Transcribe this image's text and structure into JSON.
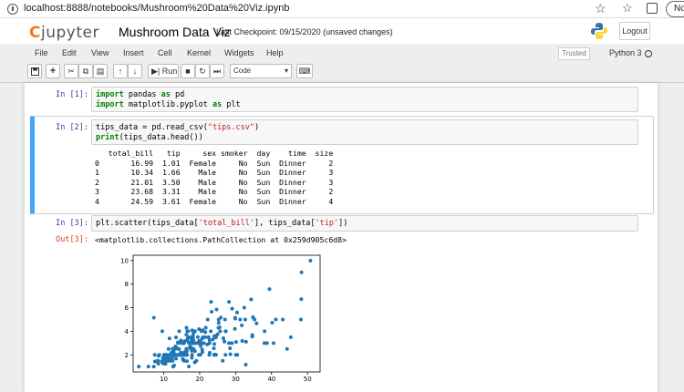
{
  "browser": {
    "url": "localhost:8888/notebooks/Mushroom%20Data%20Viz.ipynb",
    "profile_label": "No"
  },
  "header": {
    "logo_text": "jupyter",
    "notebook_name": "Mushroom Data Viz",
    "checkpoint": "Last Checkpoint: 09/15/2020  (unsaved changes)",
    "logout_label": "Logout"
  },
  "menu": {
    "items": [
      "File",
      "Edit",
      "View",
      "Insert",
      "Cell",
      "Kernel",
      "Widgets",
      "Help"
    ],
    "trusted_label": "Trusted",
    "kernel_name": "Python 3"
  },
  "toolbar": {
    "run_label": "Run",
    "cell_type": "Code",
    "icons": [
      "save-icon",
      "add-cell-icon",
      "cut-icon",
      "copy-icon",
      "paste-icon",
      "move-up-icon",
      "move-down-icon",
      "run-icon",
      "stop-icon",
      "restart-icon",
      "fast-forward-icon",
      "keyboard-icon"
    ]
  },
  "cells": [
    {
      "prompt": "In [1]:",
      "code": [
        [
          {
            "t": "import",
            "c": "kw"
          },
          {
            "t": " pandas "
          },
          {
            "t": "as",
            "c": "kw"
          },
          {
            "t": " pd"
          }
        ],
        [
          {
            "t": "import",
            "c": "kw"
          },
          {
            "t": " matplotlib.pyplot "
          },
          {
            "t": "as",
            "c": "kw"
          },
          {
            "t": " plt"
          }
        ]
      ]
    },
    {
      "prompt": "In [2]:",
      "code": [
        [
          {
            "t": "tips_data = pd.read_csv("
          },
          {
            "t": "\"tips.csv\"",
            "c": "str"
          },
          {
            "t": ")"
          }
        ],
        [
          {
            "t": "print",
            "c": "kw"
          },
          {
            "t": "(tips_data.head())"
          }
        ]
      ],
      "output": "   total_bill   tip     sex smoker  day    time  size\n0       16.99  1.01  Female     No  Sun  Dinner     2\n1       10.34  1.66    Male     No  Sun  Dinner     3\n2       21.01  3.50    Male     No  Sun  Dinner     3\n3       23.68  3.31    Male     No  Sun  Dinner     2\n4       24.59  3.61  Female     No  Sun  Dinner     4"
    },
    {
      "prompt": "In [3]:",
      "code": [
        [
          {
            "t": "plt.scatter(tips_data["
          },
          {
            "t": "'total_bill'",
            "c": "str"
          },
          {
            "t": "], tips_data["
          },
          {
            "t": "'tip'",
            "c": "str"
          },
          {
            "t": "])"
          }
        ]
      ],
      "out_prompt": "Out[3]:",
      "out_text": "<matplotlib.collections.PathCollection at 0x259d905c6d8>"
    }
  ],
  "chart_data": {
    "type": "scatter",
    "xlim": [
      1.5,
      53.5
    ],
    "ylim": [
      0.55,
      10.45
    ],
    "xticks": [
      10,
      20,
      30,
      40,
      50
    ],
    "yticks": [
      2,
      4,
      6,
      8,
      10
    ],
    "color": "#1f77b4",
    "grid": false,
    "points": [
      [
        3.07,
        1.0
      ],
      [
        5.75,
        1.0
      ],
      [
        7.25,
        1.0
      ],
      [
        7.25,
        5.15
      ],
      [
        7.51,
        2.0
      ],
      [
        7.56,
        1.44
      ],
      [
        7.74,
        1.44
      ],
      [
        8.35,
        1.5
      ],
      [
        8.51,
        1.25
      ],
      [
        8.52,
        1.48
      ],
      [
        8.58,
        1.92
      ],
      [
        8.77,
        2.0
      ],
      [
        9.55,
        1.45
      ],
      [
        9.6,
        4.0
      ],
      [
        9.68,
        1.32
      ],
      [
        9.78,
        1.73
      ],
      [
        9.94,
        1.56
      ],
      [
        10.07,
        1.25
      ],
      [
        10.07,
        1.83
      ],
      [
        10.09,
        2.0
      ],
      [
        10.27,
        1.71
      ],
      [
        10.33,
        1.67
      ],
      [
        10.33,
        2.0
      ],
      [
        10.34,
        1.66
      ],
      [
        10.34,
        2.0
      ],
      [
        10.51,
        1.25
      ],
      [
        10.59,
        1.61
      ],
      [
        10.63,
        2.0
      ],
      [
        10.65,
        1.5
      ],
      [
        11.02,
        1.98
      ],
      [
        11.17,
        1.5
      ],
      [
        11.24,
        1.76
      ],
      [
        11.35,
        2.5
      ],
      [
        11.38,
        2.0
      ],
      [
        11.59,
        1.5
      ],
      [
        11.61,
        3.39
      ],
      [
        11.87,
        1.63
      ],
      [
        12.02,
        1.97
      ],
      [
        12.03,
        1.5
      ],
      [
        12.16,
        2.2
      ],
      [
        12.26,
        2.0
      ],
      [
        12.43,
        1.8
      ],
      [
        12.46,
        1.5
      ],
      [
        12.48,
        2.52
      ],
      [
        12.54,
        2.5
      ],
      [
        12.6,
        1.0
      ],
      [
        12.66,
        2.5
      ],
      [
        12.69,
        2.0
      ],
      [
        12.74,
        2.01
      ],
      [
        12.76,
        2.23
      ],
      [
        12.9,
        1.1
      ],
      [
        13.0,
        2.0
      ],
      [
        13.03,
        2.0
      ],
      [
        13.13,
        2.0
      ],
      [
        13.27,
        2.5
      ],
      [
        13.28,
        2.72
      ],
      [
        13.37,
        2.0
      ],
      [
        13.39,
        2.61
      ],
      [
        13.42,
        1.68
      ],
      [
        13.42,
        3.48
      ],
      [
        13.51,
        2.0
      ],
      [
        13.81,
        2.0
      ],
      [
        13.94,
        3.06
      ],
      [
        14.0,
        3.0
      ],
      [
        14.07,
        2.5
      ],
      [
        14.15,
        2.0
      ],
      [
        14.26,
        2.5
      ],
      [
        14.31,
        4.0
      ],
      [
        14.48,
        2.0
      ],
      [
        14.52,
        2.0
      ],
      [
        14.73,
        2.2
      ],
      [
        14.78,
        3.23
      ],
      [
        14.83,
        3.02
      ],
      [
        15.01,
        2.09
      ],
      [
        15.04,
        1.96
      ],
      [
        15.06,
        3.0
      ],
      [
        15.36,
        1.64
      ],
      [
        15.38,
        3.0
      ],
      [
        15.42,
        1.57
      ],
      [
        15.48,
        2.02
      ],
      [
        15.53,
        3.0
      ],
      [
        15.69,
        1.5
      ],
      [
        15.69,
        3.0
      ],
      [
        15.77,
        2.23
      ],
      [
        15.81,
        3.16
      ],
      [
        15.95,
        2.0
      ],
      [
        15.98,
        2.03
      ],
      [
        16.0,
        2.0
      ],
      [
        16.04,
        2.24
      ],
      [
        16.21,
        2.0
      ],
      [
        16.27,
        2.5
      ],
      [
        16.29,
        3.71
      ],
      [
        16.31,
        2.0
      ],
      [
        16.32,
        4.3
      ],
      [
        16.4,
        2.5
      ],
      [
        16.43,
        2.3
      ],
      [
        16.45,
        1.47
      ],
      [
        16.47,
        3.23
      ],
      [
        16.49,
        2.0
      ],
      [
        16.58,
        4.0
      ],
      [
        16.66,
        3.4
      ],
      [
        16.82,
        4.0
      ],
      [
        16.93,
        3.07
      ],
      [
        16.97,
        3.5
      ],
      [
        16.99,
        1.01
      ],
      [
        17.07,
        3.0
      ],
      [
        17.29,
        2.71
      ],
      [
        17.31,
        3.5
      ],
      [
        17.46,
        2.54
      ],
      [
        17.47,
        3.5
      ],
      [
        17.51,
        3.0
      ],
      [
        17.59,
        2.64
      ],
      [
        17.78,
        3.27
      ],
      [
        17.81,
        2.34
      ],
      [
        17.82,
        1.75
      ],
      [
        17.89,
        2.0
      ],
      [
        17.92,
        4.08
      ],
      [
        18.04,
        3.0
      ],
      [
        18.15,
        3.5
      ],
      [
        18.24,
        3.76
      ],
      [
        18.26,
        3.25
      ],
      [
        18.28,
        4.0
      ],
      [
        18.29,
        3.0
      ],
      [
        18.35,
        2.5
      ],
      [
        18.43,
        3.0
      ],
      [
        18.64,
        1.36
      ],
      [
        18.69,
        2.31
      ],
      [
        18.71,
        4.0
      ],
      [
        18.78,
        3.0
      ],
      [
        19.08,
        1.5
      ],
      [
        19.44,
        3.0
      ],
      [
        19.49,
        3.51
      ],
      [
        19.65,
        3.0
      ],
      [
        19.77,
        2.0
      ],
      [
        19.81,
        4.19
      ],
      [
        19.82,
        3.18
      ],
      [
        20.08,
        3.15
      ],
      [
        20.23,
        2.01
      ],
      [
        20.27,
        2.83
      ],
      [
        20.29,
        2.75
      ],
      [
        20.45,
        3.0
      ],
      [
        20.49,
        4.06
      ],
      [
        20.53,
        4.0
      ],
      [
        20.65,
        3.35
      ],
      [
        20.69,
        2.45
      ],
      [
        20.76,
        2.24
      ],
      [
        20.9,
        3.5
      ],
      [
        20.92,
        4.08
      ],
      [
        21.01,
        3.5
      ],
      [
        21.16,
        3.0
      ],
      [
        21.5,
        3.5
      ],
      [
        21.58,
        3.92
      ],
      [
        21.7,
        4.3
      ],
      [
        22.12,
        2.88
      ],
      [
        22.23,
        5.0
      ],
      [
        22.42,
        3.48
      ],
      [
        22.49,
        3.5
      ],
      [
        22.67,
        2.0
      ],
      [
        22.75,
        3.25
      ],
      [
        22.76,
        3.0
      ],
      [
        22.82,
        2.18
      ],
      [
        23.1,
        4.0
      ],
      [
        23.17,
        6.5
      ],
      [
        23.33,
        5.65
      ],
      [
        23.68,
        3.31
      ],
      [
        23.95,
        2.55
      ],
      [
        24.01,
        2.0
      ],
      [
        24.06,
        3.6
      ],
      [
        24.08,
        2.92
      ],
      [
        24.27,
        2.03
      ],
      [
        24.52,
        3.48
      ],
      [
        24.55,
        2.0
      ],
      [
        24.59,
        3.61
      ],
      [
        24.71,
        5.85
      ],
      [
        25.0,
        3.75
      ],
      [
        25.21,
        4.29
      ],
      [
        25.28,
        5.0
      ],
      [
        25.29,
        4.71
      ],
      [
        25.56,
        4.34
      ],
      [
        25.71,
        4.0
      ],
      [
        25.89,
        5.16
      ],
      [
        26.41,
        1.5
      ],
      [
        26.59,
        3.41
      ],
      [
        26.86,
        3.14
      ],
      [
        26.88,
        3.12
      ],
      [
        27.05,
        5.0
      ],
      [
        27.18,
        2.0
      ],
      [
        27.2,
        4.0
      ],
      [
        27.28,
        4.0
      ],
      [
        28.15,
        3.0
      ],
      [
        28.17,
        6.5
      ],
      [
        28.44,
        2.56
      ],
      [
        28.55,
        2.05
      ],
      [
        28.97,
        3.0
      ],
      [
        29.03,
        5.92
      ],
      [
        29.8,
        4.2
      ],
      [
        29.85,
        5.14
      ],
      [
        29.93,
        5.07
      ],
      [
        30.06,
        2.0
      ],
      [
        30.14,
        3.09
      ],
      [
        30.4,
        5.6
      ],
      [
        30.46,
        2.0
      ],
      [
        31.27,
        5.0
      ],
      [
        31.71,
        4.5
      ],
      [
        31.85,
        3.18
      ],
      [
        32.4,
        6.0
      ],
      [
        32.68,
        5.0
      ],
      [
        32.83,
        1.17
      ],
      [
        32.9,
        3.11
      ],
      [
        34.3,
        6.7
      ],
      [
        34.63,
        3.55
      ],
      [
        34.65,
        3.68
      ],
      [
        34.81,
        5.2
      ],
      [
        34.83,
        5.17
      ],
      [
        35.26,
        5.0
      ],
      [
        35.83,
        4.67
      ],
      [
        38.01,
        3.0
      ],
      [
        38.07,
        4.0
      ],
      [
        38.73,
        3.0
      ],
      [
        39.42,
        7.58
      ],
      [
        40.17,
        4.73
      ],
      [
        40.55,
        3.0
      ],
      [
        41.19,
        5.0
      ],
      [
        43.11,
        5.0
      ],
      [
        44.3,
        2.5
      ],
      [
        45.35,
        3.5
      ],
      [
        48.17,
        5.0
      ],
      [
        48.27,
        6.73
      ],
      [
        48.33,
        9.0
      ],
      [
        50.81,
        10.0
      ]
    ]
  }
}
